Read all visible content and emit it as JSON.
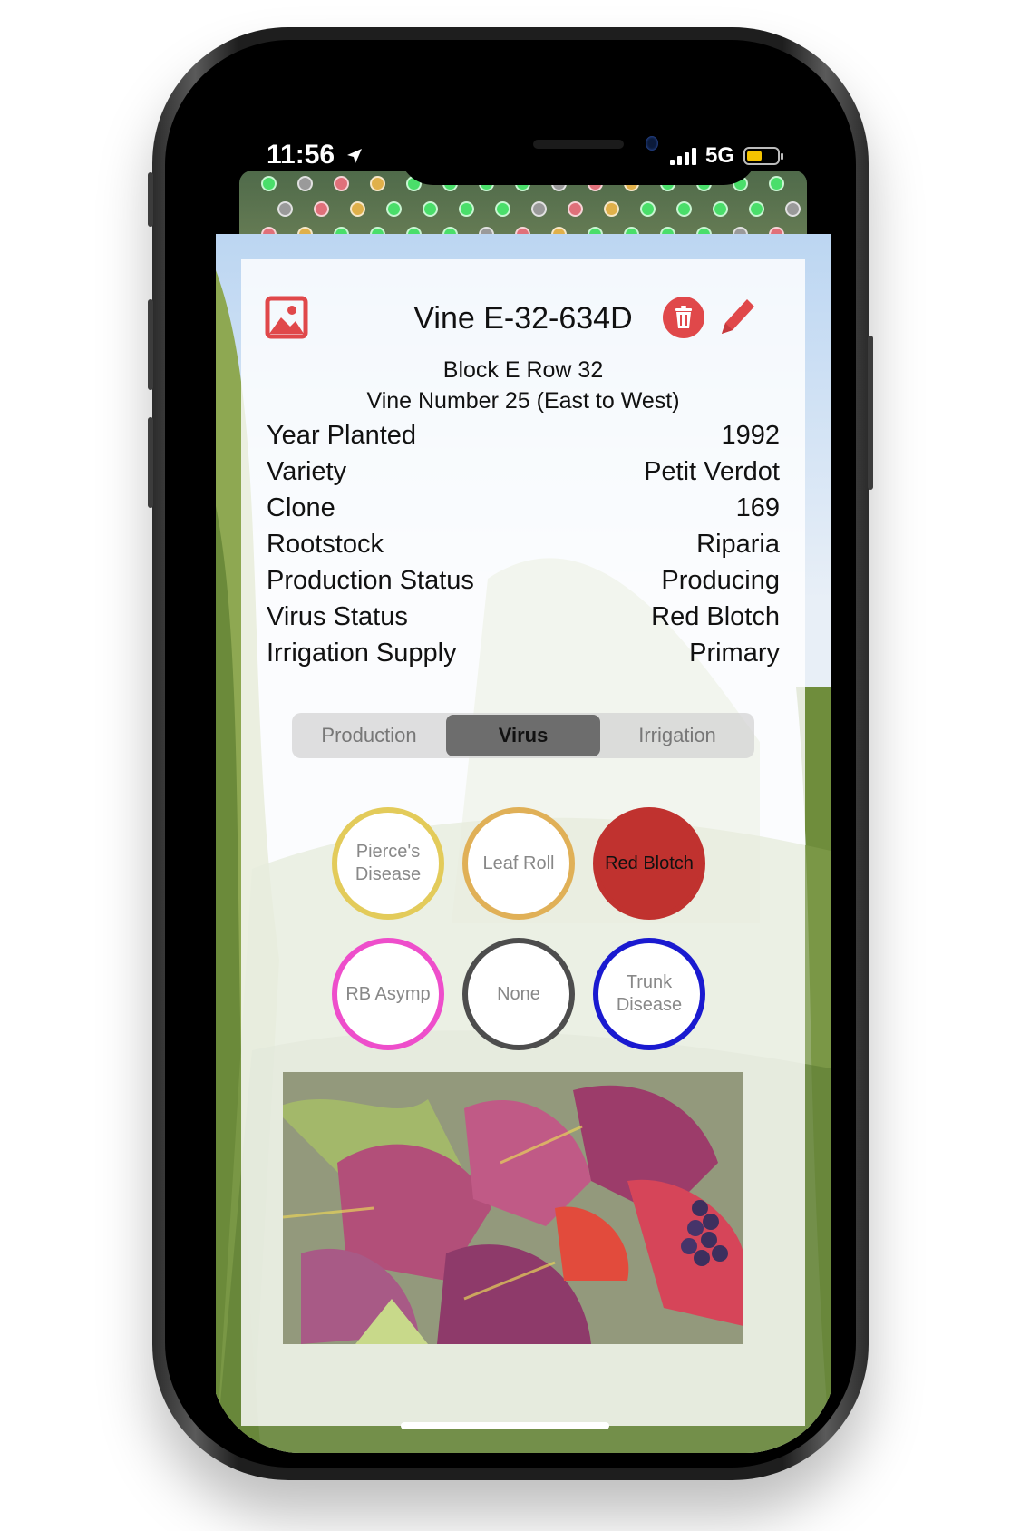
{
  "status_bar": {
    "time": "11:56",
    "network": "5G"
  },
  "header": {
    "title": "Vine E-32-634D"
  },
  "location": {
    "line1": "Block E Row 32",
    "line2": "Vine Number 25 (East to West)"
  },
  "details": [
    {
      "label": "Year Planted",
      "value": "1992"
    },
    {
      "label": "Variety",
      "value": "Petit Verdot"
    },
    {
      "label": "Clone",
      "value": "169"
    },
    {
      "label": "Rootstock",
      "value": "Riparia"
    },
    {
      "label": "Production Status",
      "value": "Producing"
    },
    {
      "label": "Virus Status",
      "value": "Red Blotch"
    },
    {
      "label": "Irrigation Supply",
      "value": "Primary"
    }
  ],
  "tabs": [
    {
      "label": "Production"
    },
    {
      "label": "Virus",
      "selected": true
    },
    {
      "label": "Irrigation"
    }
  ],
  "virus_options": [
    {
      "label": "Pierce's Disease",
      "color": "#e3cb5a",
      "selected": false
    },
    {
      "label": "Leaf Roll",
      "color": "#e0b057",
      "selected": false
    },
    {
      "label": "Red Blotch",
      "color": "#c0322f",
      "selected": true
    },
    {
      "label": "RB Asymp",
      "color": "#ee4ecb",
      "selected": false
    },
    {
      "label": "None",
      "color": "#4d4d4d",
      "selected": false
    },
    {
      "label": "Trunk Disease",
      "color": "#1a1ad0",
      "selected": false
    }
  ],
  "icons": {
    "photo": "image-icon",
    "delete": "trash-icon",
    "edit": "pencil-icon",
    "location": "location-arrow-icon"
  },
  "colors": {
    "accent": "#e0484a",
    "selected_tab": "#6d6d6d"
  }
}
